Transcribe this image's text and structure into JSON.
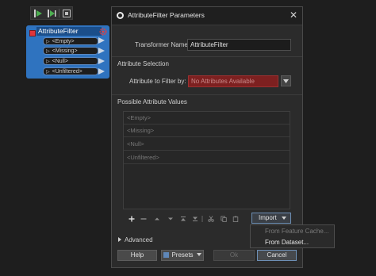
{
  "canvas": {
    "node": {
      "title": "AttributeFilter",
      "ports": [
        "<Empty>",
        "<Missing>",
        "<Null>",
        "<Unfiltered>"
      ]
    }
  },
  "dialog": {
    "title": "AttributeFilter Parameters",
    "transformer_name_label": "Transformer Name:",
    "transformer_name_value": "AttributeFilter",
    "attribute_selection_header": "Attribute Selection",
    "filter_label": "Attribute to Filter by:",
    "filter_value": "No Attributes Available",
    "possible_values_header": "Possible Attribute Values",
    "values": [
      "<Empty>",
      "<Missing>",
      "<Null>",
      "<Unfiltered>"
    ],
    "import_label": "Import",
    "advanced_label": "Advanced",
    "buttons": {
      "help": "Help",
      "presets": "Presets",
      "ok": "Ok",
      "cancel": "Cancel"
    }
  },
  "import_menu": {
    "items": [
      "From Feature Cache...",
      "From Dataset..."
    ]
  },
  "colors": {
    "node_blue": "#2f73bf",
    "error_red": "#7d2020",
    "accent_border": "#6d8fb5"
  }
}
